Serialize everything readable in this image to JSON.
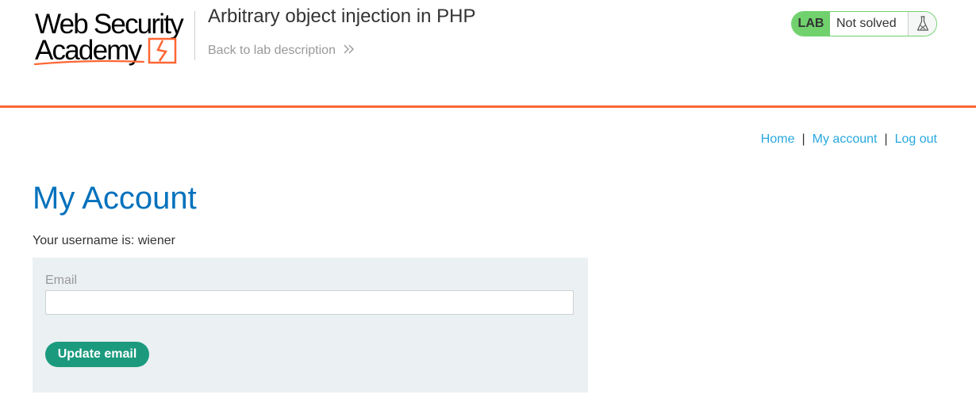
{
  "header": {
    "logo": {
      "line1": "Web Security",
      "line2": "Academy",
      "icon": "lightning-box-icon"
    },
    "lab_title": "Arbitrary object injection in PHP",
    "back_link": {
      "label": "Back to lab description",
      "icon": "double-chevron-right-icon"
    },
    "lab_status": {
      "badge": "LAB",
      "state": "Not solved",
      "icon": "flask-icon"
    }
  },
  "nav": {
    "items": [
      {
        "label": "Home"
      },
      {
        "label": "My account"
      },
      {
        "label": "Log out"
      }
    ],
    "separator": "|"
  },
  "main": {
    "title": "My Account",
    "username_line": "Your username is: wiener",
    "form": {
      "email_label": "Email",
      "email_value": "",
      "submit_label": "Update email"
    }
  },
  "colors": {
    "accent_orange": "#ff6633",
    "title_blue": "#0071bc",
    "link_blue": "#29a8de",
    "lab_green": "#70d16d",
    "button_green": "#1b9a7e",
    "form_bg": "#ebf0f2"
  }
}
